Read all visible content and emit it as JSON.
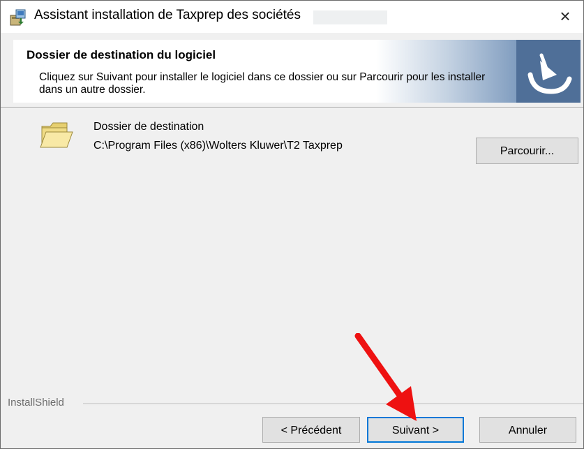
{
  "window": {
    "title": "Assistant installation de Taxprep des sociétés",
    "close_glyph": "×"
  },
  "banner": {
    "title": "Dossier de destination du logiciel",
    "description": "Cliquez sur Suivant pour installer le logiciel dans ce dossier ou sur Parcourir pour les installer dans un autre dossier."
  },
  "destination": {
    "label": "Dossier de destination",
    "path": "C:\\Program Files (x86)\\Wolters Kluwer\\T2 Taxprep",
    "browse_label": "Parcourir..."
  },
  "footer": {
    "brand": "InstallShield",
    "back_label": "< Précédent",
    "next_label": "Suivant >",
    "cancel_label": "Annuler"
  },
  "icons": {
    "app": "installer-package-icon",
    "banner_logo": "taxprep-logo-icon",
    "folder": "folder-icon",
    "annotation": "red-arrow-annotation"
  },
  "colors": {
    "dialog_bg": "#f0f0f0",
    "banner_logo_bg": "#4f6f98",
    "focus_border": "#0078d7",
    "annotation_arrow": "#ee1111"
  }
}
